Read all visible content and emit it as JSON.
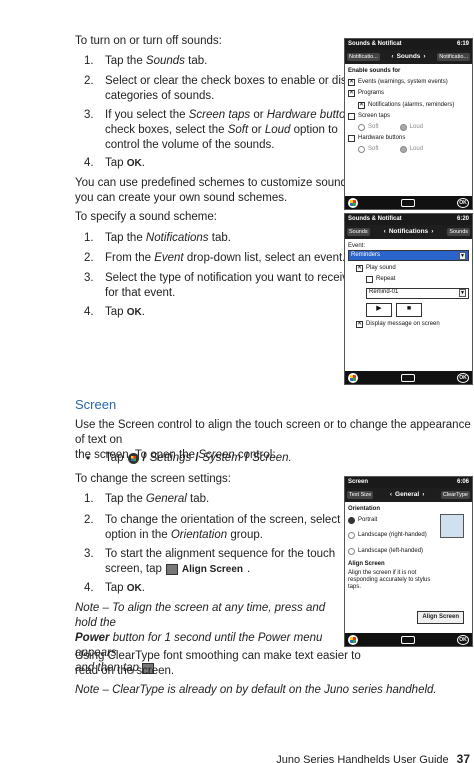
{
  "intro": "To turn on or turn off sounds:",
  "sounds_steps": [
    {
      "n": "1.",
      "a": "Tap the ",
      "i": "Sounds",
      "b": " tab."
    },
    {
      "n": "2.",
      "l1": "Select or clear the check boxes to enable or disable",
      "l2": "categories of sounds."
    },
    {
      "n": "3.",
      "l1a": "If you select the ",
      "l1i": "Screen taps",
      "l1b": " or ",
      "l1i2": "Hardware buttons",
      "l2a": "check boxes, select the ",
      "l2i": "Soft",
      "l2b": " or ",
      "l2i2": "Loud",
      "l2c": " option to",
      "l3": "control the volume of the sounds."
    },
    {
      "n": "4.",
      "a": "Tap ",
      "k": "OK",
      "b": "."
    }
  ],
  "scheme_p1": "You can use predefined schemes to customize sounds, or",
  "scheme_p2": "you can create your own sound schemes.",
  "scheme_intro": "To specify a sound scheme:",
  "scheme_steps": [
    {
      "n": "1.",
      "a": "Tap the ",
      "i": "Notifications",
      "b": " tab."
    },
    {
      "n": "2.",
      "a": "From the ",
      "i": "Event",
      "b": " drop-down list, select an event."
    },
    {
      "n": "3.",
      "l1": "Select the type of notification you want to receive",
      "l2": "for that event."
    },
    {
      "n": "4.",
      "a": "Tap ",
      "k": "OK",
      "b": "."
    }
  ],
  "screen_heading": "Screen",
  "screen_p1": "Use the Screen control to align the touch screen or to change the appearance of text on",
  "screen_p2a": "the screen. To open the ",
  "screen_p2i": "Screen",
  "screen_p2b": " control:",
  "tap_path": {
    "bullet": "•",
    "tap": "Tap",
    "sep": "/",
    "settings": "Settings",
    "system": "System",
    "screen": "Screen."
  },
  "change_intro": "To change the screen settings:",
  "screen_steps": [
    {
      "n": "1.",
      "a": "Tap the ",
      "i": "General",
      "b": " tab."
    },
    {
      "n": "2.",
      "l1": "To change the orientation of the screen, select an",
      "l2a": "option in the ",
      "l2i": "Orientation",
      "l2b": " group."
    },
    {
      "n": "3.",
      "l1": "To start the alignment sequence for the touch",
      "l2a": "screen, tap",
      "l2k": "Align Screen",
      "l2b": "."
    },
    {
      "n": "4.",
      "a": "Tap ",
      "k": "OK",
      "b": "."
    }
  ],
  "note1": {
    "l1": "Note – To align the screen at any time, press and hold the",
    "l2k": "Power",
    "l2": " button for 1 second until the Power menu appears",
    "l3": "and then tap"
  },
  "cleartype1": "Using ClearType font smoothing can make text easier to",
  "cleartype2": "read on the screen.",
  "note2": "Note – ClearType is already on by default on the Juno series handheld.",
  "footer": {
    "title": "Juno Series Handhelds User Guide",
    "page": "37"
  },
  "phone1": {
    "title": "Sounds & Notificat",
    "time": "6:19",
    "tab_left": "Notificatio...",
    "tab_mid": "Sounds",
    "tab_right": "Notificatio...",
    "section": "Enable sounds for",
    "checks": [
      "Events (warnings, system events)",
      "Programs",
      "Notifications (alarms, reminders)",
      "Screen taps",
      "Hardware buttons"
    ],
    "soft": "Soft",
    "loud": "Loud",
    "ok": "OK"
  },
  "phone2": {
    "title": "Sounds & Notificat",
    "time": "6:20",
    "tab_left": "Sounds",
    "tab_mid": "Notifications",
    "tab_right": "Sounds",
    "event_label": "Event:",
    "event_value": "Reminders",
    "play_sound": "Play sound",
    "repeat": "Repeat",
    "sound_value": "Remind-01",
    "play": "▶",
    "stop": "■",
    "display_msg": "Display message on screen",
    "ok": "OK"
  },
  "phone3": {
    "title": "Screen",
    "time": "6:06",
    "tab_left": "Text Size",
    "tab_mid": "General",
    "tab_right": "ClearType",
    "section": "Orientation",
    "portrait": "Portrait",
    "landscape_r": "Landscape (right-handed)",
    "landscape_l": "Landscape (left-handed)",
    "align_title": "Align Screen",
    "align_desc": "Align the screen if it is not responding accurately to stylus taps.",
    "align_btn": "Align Screen",
    "ok": "OK"
  }
}
